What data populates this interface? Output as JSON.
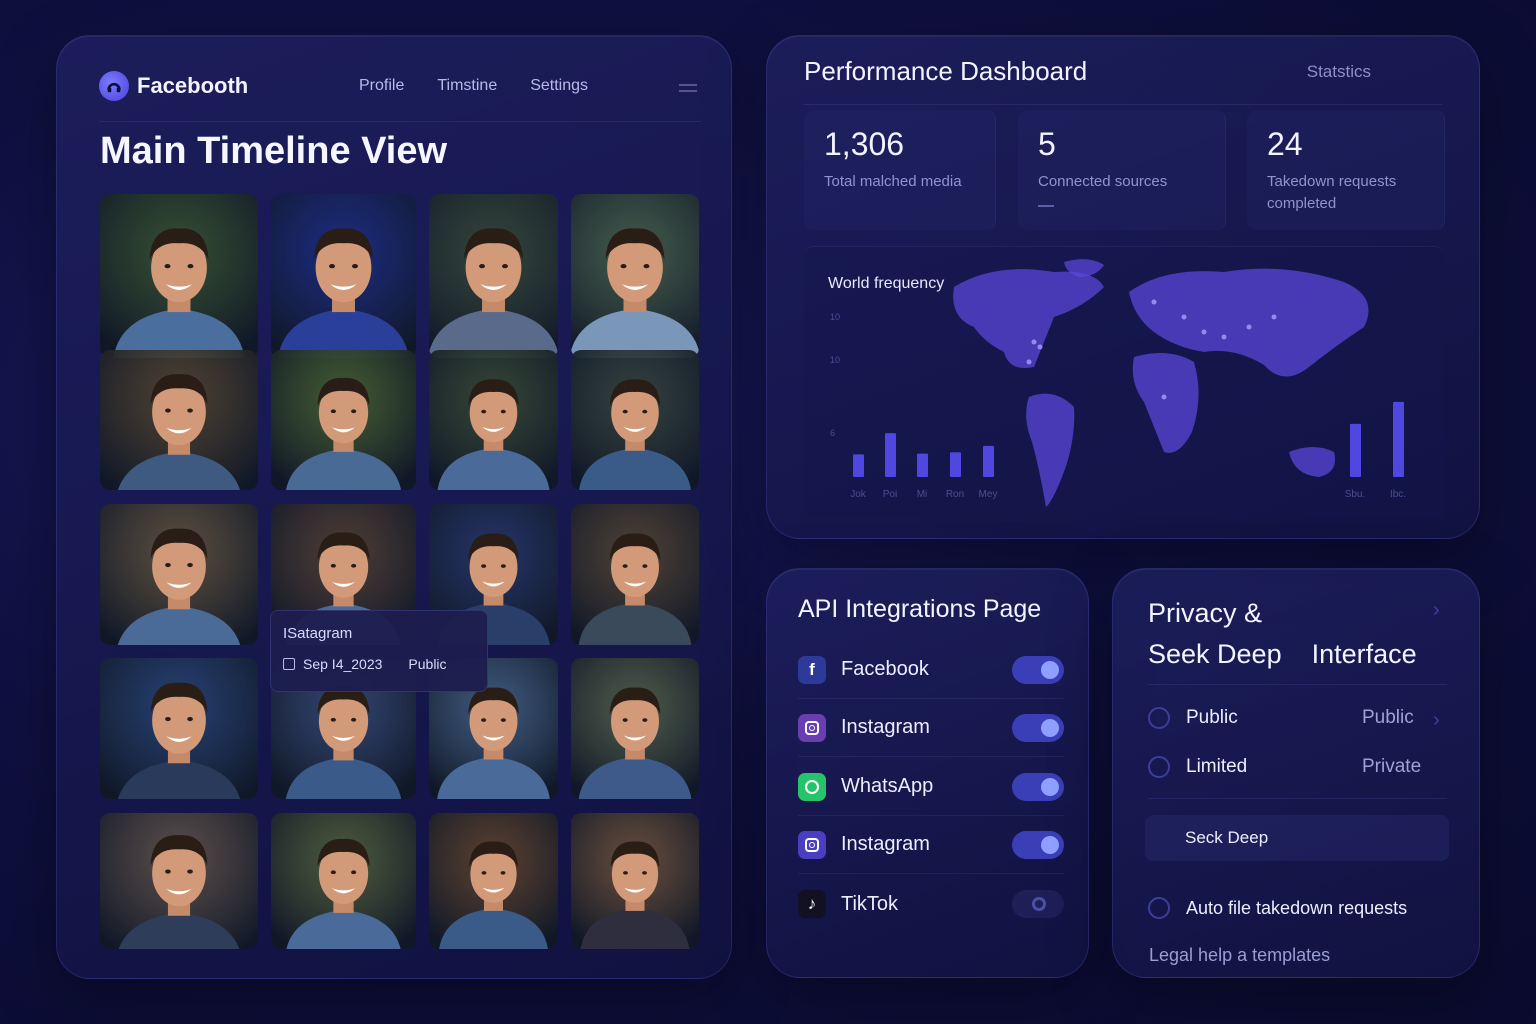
{
  "app": {
    "name": "Facebooth",
    "nav": [
      "Profile",
      "Timstine",
      "Settings"
    ]
  },
  "timeline": {
    "title": "Main Timeline View",
    "tooltip": {
      "source": "ISatagram",
      "date": "Sep I4_2023",
      "visibility": "Public"
    }
  },
  "dashboard": {
    "title": "Performance Dashboard",
    "link": "Statstics",
    "stats": [
      {
        "value": "1,306",
        "label": "Total malched media"
      },
      {
        "value": "5",
        "label": "Connected sources"
      },
      {
        "value": "24",
        "label": "Takedown requests completed"
      }
    ],
    "map_label": "World frequency"
  },
  "chart_data": {
    "type": "bar",
    "title": "World frequency",
    "y_ticks": [
      "10",
      "10",
      "6"
    ],
    "categories": [
      "Jok",
      "Poi",
      "Mi",
      "Ron",
      "Mey",
      "Sbu.",
      "Ibc."
    ],
    "values": [
      3.2,
      6.2,
      3.3,
      3.5,
      4.4,
      7.5,
      10.6
    ],
    "ylim": [
      0,
      12
    ],
    "grid": false
  },
  "api": {
    "title": "API Integrations Page",
    "items": [
      {
        "name": "Facebook",
        "icon": "facebook-icon",
        "enabled": true,
        "color": "#2d3a9a"
      },
      {
        "name": "Instagram",
        "icon": "instagram-icon",
        "enabled": true,
        "color": "#6a3db0"
      },
      {
        "name": "WhatsApp",
        "icon": "whatsapp-icon",
        "enabled": true,
        "color": "#25c46a"
      },
      {
        "name": "Instagram",
        "icon": "instagram-icon",
        "enabled": true,
        "color": "#4a3fc0"
      },
      {
        "name": "TikTok",
        "icon": "tiktok-icon",
        "enabled": false,
        "color": "#111122"
      }
    ]
  },
  "privacy": {
    "title_line1": "Privacy &",
    "title_line2a": "Seek Deep",
    "title_line2b": "Interface",
    "options": [
      {
        "label": "Public",
        "value": "Public"
      },
      {
        "label": "Limited",
        "value": "Private"
      }
    ],
    "seek": "Seck Deep",
    "auto": "Auto file takedown requests",
    "legal": "Legal help a templates"
  },
  "colors": {
    "accent": "#5b5cff",
    "background": "#0f1040",
    "panel": "#1a1c5a"
  }
}
